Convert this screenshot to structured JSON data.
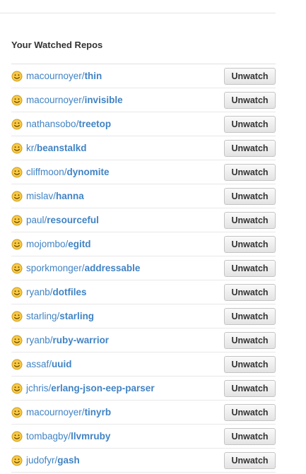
{
  "section": {
    "title": "Your Watched Repos",
    "unwatch_label": "Unwatch"
  },
  "colors": {
    "link": "#4183c4",
    "smiley_fill": "#f7c948",
    "smiley_stroke": "#c99a1c"
  },
  "repos": [
    {
      "owner": "macournoyer",
      "name": "thin",
      "icon": "smiley-icon",
      "action": "Unwatch"
    },
    {
      "owner": "macournoyer",
      "name": "invisible",
      "icon": "smiley-icon",
      "action": "Unwatch"
    },
    {
      "owner": "nathansobo",
      "name": "treetop",
      "icon": "smiley-icon",
      "action": "Unwatch"
    },
    {
      "owner": "kr",
      "name": "beanstalkd",
      "icon": "smiley-icon",
      "action": "Unwatch"
    },
    {
      "owner": "cliffmoon",
      "name": "dynomite",
      "icon": "smiley-icon",
      "action": "Unwatch"
    },
    {
      "owner": "mislav",
      "name": "hanna",
      "icon": "smiley-icon",
      "action": "Unwatch"
    },
    {
      "owner": "paul",
      "name": "resourceful",
      "icon": "smiley-icon",
      "action": "Unwatch"
    },
    {
      "owner": "mojombo",
      "name": "egitd",
      "icon": "smiley-icon",
      "action": "Unwatch"
    },
    {
      "owner": "sporkmonger",
      "name": "addressable",
      "icon": "smiley-icon",
      "action": "Unwatch"
    },
    {
      "owner": "ryanb",
      "name": "dotfiles",
      "icon": "smiley-icon",
      "action": "Unwatch"
    },
    {
      "owner": "starling",
      "name": "starling",
      "icon": "smiley-icon",
      "action": "Unwatch"
    },
    {
      "owner": "ryanb",
      "name": "ruby-warrior",
      "icon": "smiley-icon",
      "action": "Unwatch"
    },
    {
      "owner": "assaf",
      "name": "uuid",
      "icon": "smiley-icon",
      "action": "Unwatch"
    },
    {
      "owner": "jchris",
      "name": "erlang-json-eep-parser",
      "icon": "smiley-icon",
      "action": "Unwatch"
    },
    {
      "owner": "macournoyer",
      "name": "tinyrb",
      "icon": "smiley-icon",
      "action": "Unwatch"
    },
    {
      "owner": "tombagby",
      "name": "llvmruby",
      "icon": "smiley-icon",
      "action": "Unwatch"
    },
    {
      "owner": "judofyr",
      "name": "gash",
      "icon": "smiley-icon",
      "action": "Unwatch"
    }
  ]
}
